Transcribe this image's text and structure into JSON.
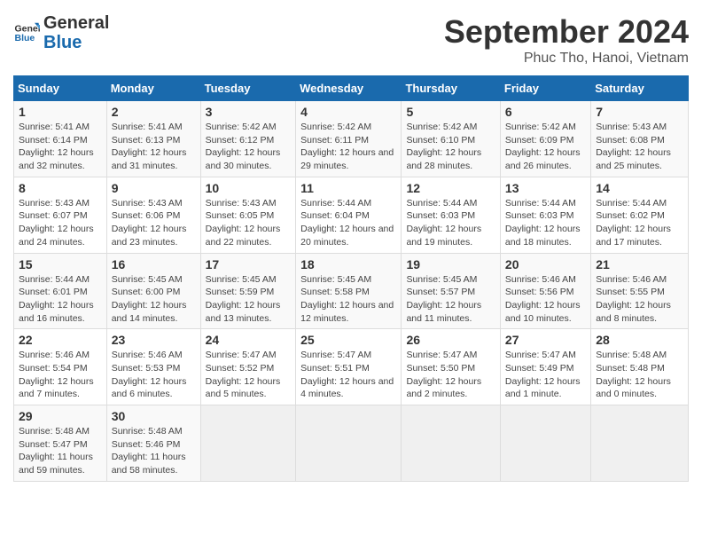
{
  "header": {
    "logo_general": "General",
    "logo_blue": "Blue",
    "month_title": "September 2024",
    "location": "Phuc Tho, Hanoi, Vietnam"
  },
  "days_of_week": [
    "Sunday",
    "Monday",
    "Tuesday",
    "Wednesday",
    "Thursday",
    "Friday",
    "Saturday"
  ],
  "weeks": [
    [
      {
        "day": "1",
        "sunrise": "5:41 AM",
        "sunset": "6:14 PM",
        "daylight": "12 hours and 32 minutes."
      },
      {
        "day": "2",
        "sunrise": "5:41 AM",
        "sunset": "6:13 PM",
        "daylight": "12 hours and 31 minutes."
      },
      {
        "day": "3",
        "sunrise": "5:42 AM",
        "sunset": "6:12 PM",
        "daylight": "12 hours and 30 minutes."
      },
      {
        "day": "4",
        "sunrise": "5:42 AM",
        "sunset": "6:11 PM",
        "daylight": "12 hours and 29 minutes."
      },
      {
        "day": "5",
        "sunrise": "5:42 AM",
        "sunset": "6:10 PM",
        "daylight": "12 hours and 28 minutes."
      },
      {
        "day": "6",
        "sunrise": "5:42 AM",
        "sunset": "6:09 PM",
        "daylight": "12 hours and 26 minutes."
      },
      {
        "day": "7",
        "sunrise": "5:43 AM",
        "sunset": "6:08 PM",
        "daylight": "12 hours and 25 minutes."
      }
    ],
    [
      {
        "day": "8",
        "sunrise": "5:43 AM",
        "sunset": "6:07 PM",
        "daylight": "12 hours and 24 minutes."
      },
      {
        "day": "9",
        "sunrise": "5:43 AM",
        "sunset": "6:06 PM",
        "daylight": "12 hours and 23 minutes."
      },
      {
        "day": "10",
        "sunrise": "5:43 AM",
        "sunset": "6:05 PM",
        "daylight": "12 hours and 22 minutes."
      },
      {
        "day": "11",
        "sunrise": "5:44 AM",
        "sunset": "6:04 PM",
        "daylight": "12 hours and 20 minutes."
      },
      {
        "day": "12",
        "sunrise": "5:44 AM",
        "sunset": "6:03 PM",
        "daylight": "12 hours and 19 minutes."
      },
      {
        "day": "13",
        "sunrise": "5:44 AM",
        "sunset": "6:03 PM",
        "daylight": "12 hours and 18 minutes."
      },
      {
        "day": "14",
        "sunrise": "5:44 AM",
        "sunset": "6:02 PM",
        "daylight": "12 hours and 17 minutes."
      }
    ],
    [
      {
        "day": "15",
        "sunrise": "5:44 AM",
        "sunset": "6:01 PM",
        "daylight": "12 hours and 16 minutes."
      },
      {
        "day": "16",
        "sunrise": "5:45 AM",
        "sunset": "6:00 PM",
        "daylight": "12 hours and 14 minutes."
      },
      {
        "day": "17",
        "sunrise": "5:45 AM",
        "sunset": "5:59 PM",
        "daylight": "12 hours and 13 minutes."
      },
      {
        "day": "18",
        "sunrise": "5:45 AM",
        "sunset": "5:58 PM",
        "daylight": "12 hours and 12 minutes."
      },
      {
        "day": "19",
        "sunrise": "5:45 AM",
        "sunset": "5:57 PM",
        "daylight": "12 hours and 11 minutes."
      },
      {
        "day": "20",
        "sunrise": "5:46 AM",
        "sunset": "5:56 PM",
        "daylight": "12 hours and 10 minutes."
      },
      {
        "day": "21",
        "sunrise": "5:46 AM",
        "sunset": "5:55 PM",
        "daylight": "12 hours and 8 minutes."
      }
    ],
    [
      {
        "day": "22",
        "sunrise": "5:46 AM",
        "sunset": "5:54 PM",
        "daylight": "12 hours and 7 minutes."
      },
      {
        "day": "23",
        "sunrise": "5:46 AM",
        "sunset": "5:53 PM",
        "daylight": "12 hours and 6 minutes."
      },
      {
        "day": "24",
        "sunrise": "5:47 AM",
        "sunset": "5:52 PM",
        "daylight": "12 hours and 5 minutes."
      },
      {
        "day": "25",
        "sunrise": "5:47 AM",
        "sunset": "5:51 PM",
        "daylight": "12 hours and 4 minutes."
      },
      {
        "day": "26",
        "sunrise": "5:47 AM",
        "sunset": "5:50 PM",
        "daylight": "12 hours and 2 minutes."
      },
      {
        "day": "27",
        "sunrise": "5:47 AM",
        "sunset": "5:49 PM",
        "daylight": "12 hours and 1 minute."
      },
      {
        "day": "28",
        "sunrise": "5:48 AM",
        "sunset": "5:48 PM",
        "daylight": "12 hours and 0 minutes."
      }
    ],
    [
      {
        "day": "29",
        "sunrise": "5:48 AM",
        "sunset": "5:47 PM",
        "daylight": "11 hours and 59 minutes."
      },
      {
        "day": "30",
        "sunrise": "5:48 AM",
        "sunset": "5:46 PM",
        "daylight": "11 hours and 58 minutes."
      },
      null,
      null,
      null,
      null,
      null
    ]
  ],
  "labels": {
    "sunrise": "Sunrise:",
    "sunset": "Sunset:",
    "daylight": "Daylight:"
  }
}
